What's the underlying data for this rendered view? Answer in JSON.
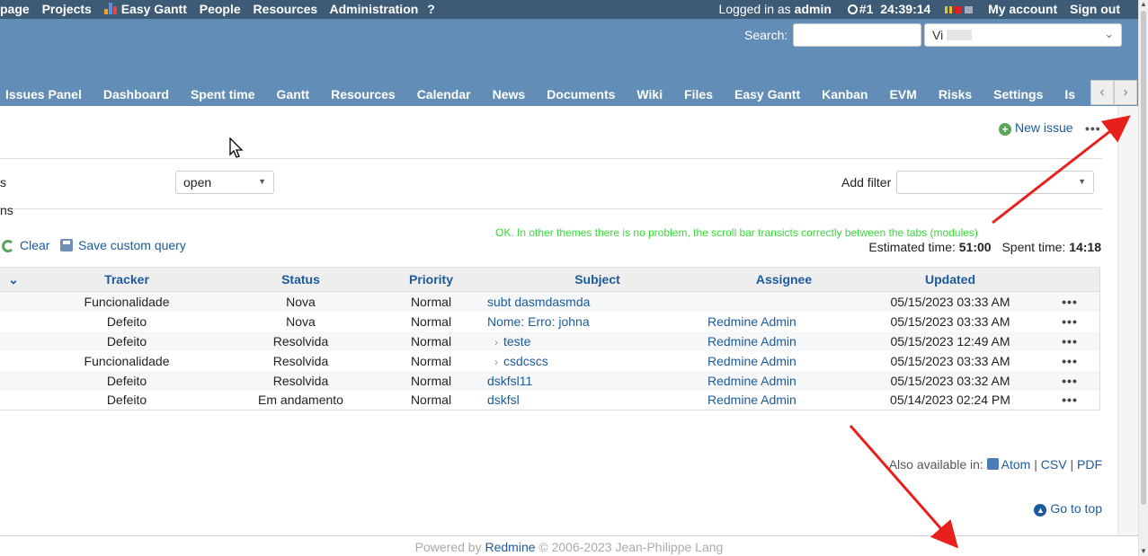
{
  "top_menu": {
    "items": [
      "page",
      "Projects",
      "Easy Gantt",
      "People",
      "Resources",
      "Administration",
      "?"
    ],
    "logged_in_prefix": "Logged in as",
    "user": "admin",
    "timer_issue": "#1",
    "timer_value": "24:39:14",
    "my_account": "My account",
    "sign_out": "Sign out"
  },
  "header": {
    "search_label": "Search:",
    "search_value": "",
    "jump_value": "Vi"
  },
  "main_menu": {
    "tabs": [
      "Issues Panel",
      "Dashboard",
      "Spent time",
      "Gantt",
      "Resources",
      "Calendar",
      "News",
      "Documents",
      "Wiki",
      "Files",
      "Easy Gantt",
      "Kanban",
      "EVM",
      "Risks",
      "Settings",
      "Is"
    ],
    "prev_arrow": "‹",
    "next_arrow": "›"
  },
  "contextual": {
    "new_issue": "New issue",
    "more": "•••"
  },
  "filters": {
    "status_label": "s",
    "status_value": "open",
    "add_filter_label": "Add filter",
    "options_label": "ns"
  },
  "query_actions": {
    "clear": "Clear",
    "save": "Save custom query"
  },
  "annotation_note": "OK. In other themes there is no problem, the scroll bar transicts correctly between the tabs (modules)",
  "totals": {
    "estimated_label": "Estimated time:",
    "estimated_value": "51:00",
    "spent_label": "Spent time:",
    "spent_value": "14:18"
  },
  "table": {
    "headers": [
      "Tracker",
      "Status",
      "Priority",
      "Subject",
      "Assignee",
      "Updated"
    ],
    "rows": [
      {
        "tracker": "Funcionalidade",
        "status": "Nova",
        "priority": "Normal",
        "subject": "subt dasmdasmda",
        "assignee": "",
        "updated": "05/15/2023 03:33 AM",
        "child": false
      },
      {
        "tracker": "Defeito",
        "status": "Nova",
        "priority": "Normal",
        "subject": "Nome: Erro: johna",
        "assignee": "Redmine Admin",
        "updated": "05/15/2023 03:33 AM",
        "child": false
      },
      {
        "tracker": "Defeito",
        "status": "Resolvida",
        "priority": "Normal",
        "subject": "teste",
        "assignee": "Redmine Admin",
        "updated": "05/15/2023 12:49 AM",
        "child": true
      },
      {
        "tracker": "Funcionalidade",
        "status": "Resolvida",
        "priority": "Normal",
        "subject": "csdcscs",
        "assignee": "Redmine Admin",
        "updated": "05/15/2023 03:33 AM",
        "child": true
      },
      {
        "tracker": "Defeito",
        "status": "Resolvida",
        "priority": "Normal",
        "subject": "dskfsl11",
        "assignee": "Redmine Admin",
        "updated": "05/15/2023 03:32 AM",
        "child": false
      },
      {
        "tracker": "Defeito",
        "status": "Em andamento",
        "priority": "Normal",
        "subject": "dskfsl",
        "assignee": "Redmine Admin",
        "updated": "05/14/2023 02:24 PM",
        "child": false
      }
    ],
    "row_menu": "•••"
  },
  "other_formats": {
    "label": "Also available in:",
    "atom": "Atom",
    "sep": "|",
    "csv": "CSV",
    "pdf": "PDF"
  },
  "go_top": "Go to top",
  "footer": {
    "powered": "Powered by",
    "redmine": "Redmine",
    "copyright": "© 2006-2023 Jean-Philippe Lang"
  },
  "colors": {
    "top_menu_bg": "#3e5b76",
    "header_bg": "#628db6",
    "link": "#1c5a9c",
    "annotation": "#e8201c",
    "note": "#33dd33"
  }
}
